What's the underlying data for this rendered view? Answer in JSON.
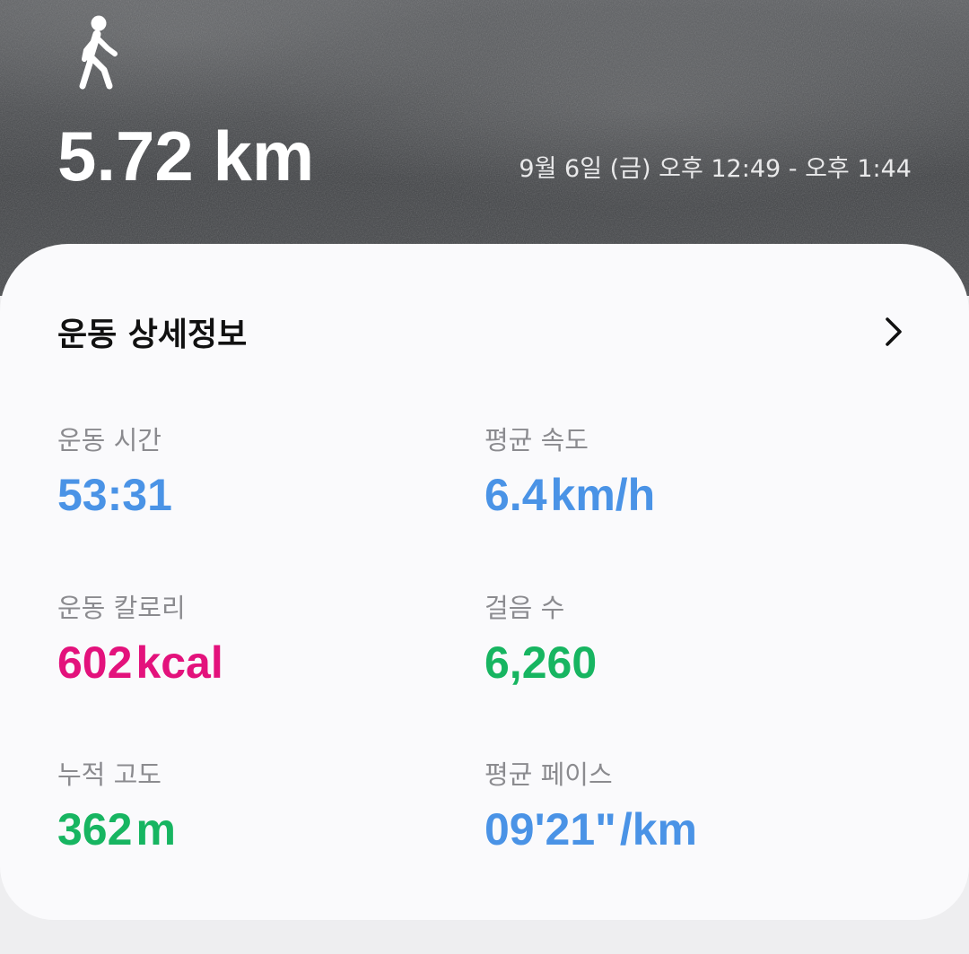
{
  "header": {
    "activity_icon": "walking-person-icon",
    "distance": "5.72 km",
    "datetime": "9월 6일 (금) 오후 12:49 - 오후 1:44"
  },
  "details": {
    "title": "운동 상세정보",
    "chevron_icon": "chevron-right-icon",
    "stats": [
      {
        "label": "운동 시간",
        "value": "53:31",
        "unit": "",
        "color": "#4a93e6"
      },
      {
        "label": "평균 속도",
        "value": "6.4",
        "unit": "km/h",
        "color": "#4a93e6"
      },
      {
        "label": "운동 칼로리",
        "value": "602",
        "unit": "kcal",
        "color": "#e3127c"
      },
      {
        "label": "걸음 수",
        "value": "6,260",
        "unit": "",
        "color": "#17b561"
      },
      {
        "label": "누적 고도",
        "value": "362",
        "unit": "m",
        "color": "#17b561"
      },
      {
        "label": "평균 페이스",
        "value": "09'21\"",
        "unit": "/km",
        "color": "#4a93e6"
      }
    ]
  },
  "colors": {
    "pace_blue": "#4a93e6",
    "calorie_pink": "#e3127c",
    "stat_green": "#17b561"
  }
}
